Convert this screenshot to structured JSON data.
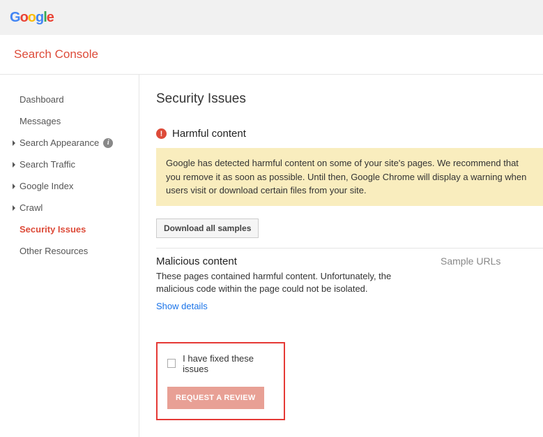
{
  "logo": {
    "g1": "G",
    "o1": "o",
    "o2": "o",
    "g2": "g",
    "l": "l",
    "e": "e"
  },
  "product_name": "Search Console",
  "sidebar": {
    "items": [
      {
        "label": "Dashboard",
        "has_caret": false,
        "has_info": false
      },
      {
        "label": "Messages",
        "has_caret": false,
        "has_info": false
      },
      {
        "label": "Search Appearance",
        "has_caret": true,
        "has_info": true
      },
      {
        "label": "Search Traffic",
        "has_caret": true,
        "has_info": false
      },
      {
        "label": "Google Index",
        "has_caret": true,
        "has_info": false
      },
      {
        "label": "Crawl",
        "has_caret": true,
        "has_info": false
      },
      {
        "label": "Security Issues",
        "has_caret": false,
        "has_info": false,
        "active": true
      },
      {
        "label": "Other Resources",
        "has_caret": false,
        "has_info": false
      }
    ]
  },
  "content": {
    "page_title": "Security Issues",
    "alert_heading": "Harmful content",
    "warning_text": "Google has detected harmful content on some of your site's pages. We recommend that you remove it as soon as possible. Until then, Google Chrome will display a warning when users visit or download certain files from your site.",
    "download_button": "Download all samples",
    "issue_title": "Malicious content",
    "issue_desc": "These pages contained harmful content. Unfortunately, the malicious code within the page could not be isolated.",
    "show_details": "Show details",
    "sample_urls_label": "Sample URLs",
    "fixed_label": "I have fixed these issues",
    "request_button": "REQUEST A REVIEW"
  }
}
